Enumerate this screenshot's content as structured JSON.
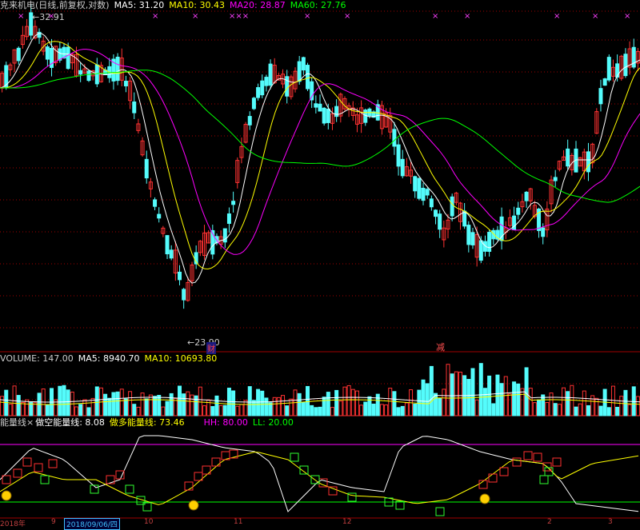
{
  "header_main": {
    "title": "克来机电(日线,前复权,对数)",
    "ma5": "MA5: 31.20",
    "ma10": "MA10: 30.43",
    "ma20": "MA20: 28.87",
    "ma60": "MA60: 27.76"
  },
  "header_volume": {
    "volume": "VOLUME: 147.00",
    "ma5": "MA5: 8940.70",
    "ma10": "MA10: 10693.80"
  },
  "header_indicator": {
    "name": "能量线×",
    "short_line": "做空能量线: 8.08",
    "long_line": "做多能量线: 73.46",
    "hh": "HH: 80.00",
    "ll": "LL: 20.00"
  },
  "annotations": {
    "peak_label": "←32.91",
    "low_label": "←23.90",
    "mark_cai": "财",
    "mark_jian": "减"
  },
  "date_axis": {
    "ticks": [
      "2018年",
      "9",
      "10",
      "11",
      "12",
      "2",
      "3"
    ],
    "cursor": "2018/09/06/四"
  },
  "colors": {
    "up": "#ff3232",
    "down": "#54fcfc",
    "ma5": "#ffffff",
    "ma10": "#ffff00",
    "ma20": "#ff00ff",
    "ma60": "#00ff00",
    "grid": "#a00000",
    "hh_line": "#ff00ff",
    "ll_line": "#00ff00"
  },
  "chart_data": {
    "type": "candlestick",
    "title": "克来机电(日线,前复权,对数)",
    "price_high": 32.91,
    "price_low": 23.9,
    "volume_last": 147.0,
    "indicator_levels": {
      "HH": 80.0,
      "LL": 20.0
    },
    "last_values": {
      "MA5": 31.2,
      "MA10": 30.43,
      "MA20": 28.87,
      "MA60": 27.76
    }
  }
}
